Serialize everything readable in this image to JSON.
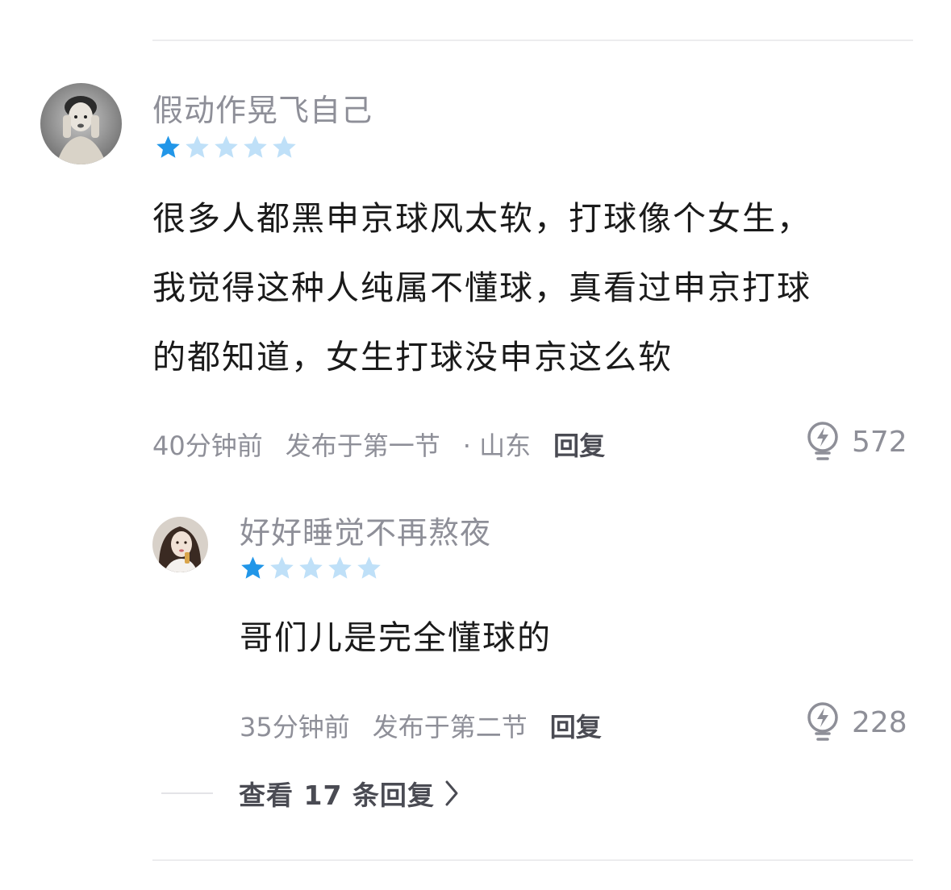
{
  "comment": {
    "username": "假动作晃飞自己",
    "rating": 1,
    "rating_max": 5,
    "lines": [
      "很多人都黑申京球风太软，打球像个女生，",
      "我觉得这种人纯属不懂球，真看过申京打球",
      "的都知道，女生打球没申京这么软"
    ],
    "time": "40分钟前",
    "posted_in": "发布于第一节",
    "location": "· 山东",
    "reply_label": "回复",
    "likes": "572"
  },
  "reply": {
    "username": "好好睡觉不再熬夜",
    "rating": 1,
    "rating_max": 5,
    "text": "哥们儿是完全懂球的",
    "time": "35分钟前",
    "posted_in": "发布于第二节",
    "reply_label": "回复",
    "likes": "228"
  },
  "view_replies": {
    "label": "查看 17 条回复"
  },
  "colors": {
    "star_filled": "#2196e8",
    "star_empty": "#bfe0f8",
    "meta_text": "#8e8f98",
    "divider": "#ececee"
  }
}
